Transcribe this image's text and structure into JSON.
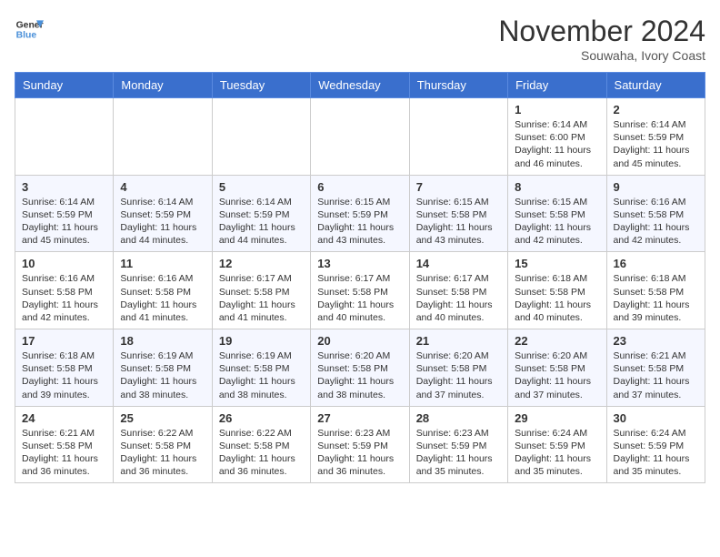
{
  "header": {
    "logo_line1": "General",
    "logo_line2": "Blue",
    "month": "November 2024",
    "location": "Souwaha, Ivory Coast"
  },
  "days_of_week": [
    "Sunday",
    "Monday",
    "Tuesday",
    "Wednesday",
    "Thursday",
    "Friday",
    "Saturday"
  ],
  "weeks": [
    [
      {
        "day": "",
        "info": ""
      },
      {
        "day": "",
        "info": ""
      },
      {
        "day": "",
        "info": ""
      },
      {
        "day": "",
        "info": ""
      },
      {
        "day": "",
        "info": ""
      },
      {
        "day": "1",
        "info": "Sunrise: 6:14 AM\nSunset: 6:00 PM\nDaylight: 11 hours and 46 minutes."
      },
      {
        "day": "2",
        "info": "Sunrise: 6:14 AM\nSunset: 5:59 PM\nDaylight: 11 hours and 45 minutes."
      }
    ],
    [
      {
        "day": "3",
        "info": "Sunrise: 6:14 AM\nSunset: 5:59 PM\nDaylight: 11 hours and 45 minutes."
      },
      {
        "day": "4",
        "info": "Sunrise: 6:14 AM\nSunset: 5:59 PM\nDaylight: 11 hours and 44 minutes."
      },
      {
        "day": "5",
        "info": "Sunrise: 6:14 AM\nSunset: 5:59 PM\nDaylight: 11 hours and 44 minutes."
      },
      {
        "day": "6",
        "info": "Sunrise: 6:15 AM\nSunset: 5:59 PM\nDaylight: 11 hours and 43 minutes."
      },
      {
        "day": "7",
        "info": "Sunrise: 6:15 AM\nSunset: 5:58 PM\nDaylight: 11 hours and 43 minutes."
      },
      {
        "day": "8",
        "info": "Sunrise: 6:15 AM\nSunset: 5:58 PM\nDaylight: 11 hours and 42 minutes."
      },
      {
        "day": "9",
        "info": "Sunrise: 6:16 AM\nSunset: 5:58 PM\nDaylight: 11 hours and 42 minutes."
      }
    ],
    [
      {
        "day": "10",
        "info": "Sunrise: 6:16 AM\nSunset: 5:58 PM\nDaylight: 11 hours and 42 minutes."
      },
      {
        "day": "11",
        "info": "Sunrise: 6:16 AM\nSunset: 5:58 PM\nDaylight: 11 hours and 41 minutes."
      },
      {
        "day": "12",
        "info": "Sunrise: 6:17 AM\nSunset: 5:58 PM\nDaylight: 11 hours and 41 minutes."
      },
      {
        "day": "13",
        "info": "Sunrise: 6:17 AM\nSunset: 5:58 PM\nDaylight: 11 hours and 40 minutes."
      },
      {
        "day": "14",
        "info": "Sunrise: 6:17 AM\nSunset: 5:58 PM\nDaylight: 11 hours and 40 minutes."
      },
      {
        "day": "15",
        "info": "Sunrise: 6:18 AM\nSunset: 5:58 PM\nDaylight: 11 hours and 40 minutes."
      },
      {
        "day": "16",
        "info": "Sunrise: 6:18 AM\nSunset: 5:58 PM\nDaylight: 11 hours and 39 minutes."
      }
    ],
    [
      {
        "day": "17",
        "info": "Sunrise: 6:18 AM\nSunset: 5:58 PM\nDaylight: 11 hours and 39 minutes."
      },
      {
        "day": "18",
        "info": "Sunrise: 6:19 AM\nSunset: 5:58 PM\nDaylight: 11 hours and 38 minutes."
      },
      {
        "day": "19",
        "info": "Sunrise: 6:19 AM\nSunset: 5:58 PM\nDaylight: 11 hours and 38 minutes."
      },
      {
        "day": "20",
        "info": "Sunrise: 6:20 AM\nSunset: 5:58 PM\nDaylight: 11 hours and 38 minutes."
      },
      {
        "day": "21",
        "info": "Sunrise: 6:20 AM\nSunset: 5:58 PM\nDaylight: 11 hours and 37 minutes."
      },
      {
        "day": "22",
        "info": "Sunrise: 6:20 AM\nSunset: 5:58 PM\nDaylight: 11 hours and 37 minutes."
      },
      {
        "day": "23",
        "info": "Sunrise: 6:21 AM\nSunset: 5:58 PM\nDaylight: 11 hours and 37 minutes."
      }
    ],
    [
      {
        "day": "24",
        "info": "Sunrise: 6:21 AM\nSunset: 5:58 PM\nDaylight: 11 hours and 36 minutes."
      },
      {
        "day": "25",
        "info": "Sunrise: 6:22 AM\nSunset: 5:58 PM\nDaylight: 11 hours and 36 minutes."
      },
      {
        "day": "26",
        "info": "Sunrise: 6:22 AM\nSunset: 5:58 PM\nDaylight: 11 hours and 36 minutes."
      },
      {
        "day": "27",
        "info": "Sunrise: 6:23 AM\nSunset: 5:59 PM\nDaylight: 11 hours and 36 minutes."
      },
      {
        "day": "28",
        "info": "Sunrise: 6:23 AM\nSunset: 5:59 PM\nDaylight: 11 hours and 35 minutes."
      },
      {
        "day": "29",
        "info": "Sunrise: 6:24 AM\nSunset: 5:59 PM\nDaylight: 11 hours and 35 minutes."
      },
      {
        "day": "30",
        "info": "Sunrise: 6:24 AM\nSunset: 5:59 PM\nDaylight: 11 hours and 35 minutes."
      }
    ]
  ]
}
